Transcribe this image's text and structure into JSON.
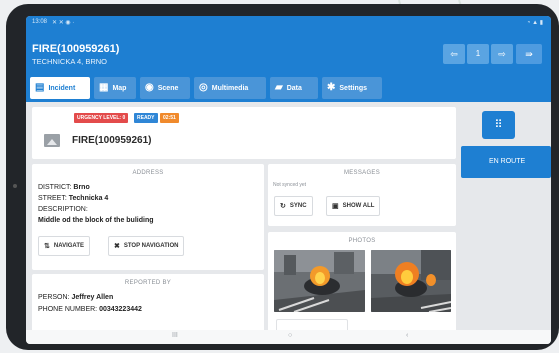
{
  "status_bar": {
    "time": "13:08",
    "icons_left": "✕ ✕ ◉ ·",
    "icons_right": "◔ ▲ ▮"
  },
  "header": {
    "title": "FIRE(100959261)",
    "subtitle": "TECHNICKA 4, BRNO",
    "nav": {
      "prev_icon": "arrow-left-icon",
      "page": "1",
      "next_icon": "arrow-right-icon",
      "exit_icon": "exit-icon"
    }
  },
  "tabs": [
    {
      "label": "Incident",
      "icon": "clipboard-icon",
      "active": true
    },
    {
      "label": "Map",
      "icon": "map-icon",
      "active": false
    },
    {
      "label": "Scene",
      "icon": "pin-icon",
      "active": false
    },
    {
      "label": "Multimedia",
      "icon": "camera-icon",
      "active": false
    },
    {
      "label": "Data",
      "icon": "folder-icon",
      "active": false
    },
    {
      "label": "Settings",
      "icon": "gear-icon",
      "active": false
    }
  ],
  "incident": {
    "badges": {
      "urgency": "URGENCY LEVEL: 0",
      "ready": "READY",
      "time": "02:51"
    },
    "title": "FIRE(100959261)"
  },
  "address": {
    "section_title": "ADDRESS",
    "district_label": "DISTRICT:",
    "district_value": "Brno",
    "street_label": "STREET:",
    "street_value": "Technicka 4",
    "description_label": "DESCRIPTION:",
    "description_value": "Middle od the block of the buliding",
    "navigate_label": "NAVIGATE",
    "stop_navigation_label": "STOP NAVIGATION"
  },
  "messages": {
    "section_title": "MESSAGES",
    "status": "Not synced yet",
    "sync_label": "SYNC",
    "show_all_label": "SHOW ALL"
  },
  "photos": {
    "section_title": "PHOTOS"
  },
  "reported_by": {
    "section_title": "REPORTED BY",
    "person_label": "PERSON:",
    "person_value": "Jeffrey Allen",
    "phone_label": "PHONE NUMBER:",
    "phone_value": "00343223442"
  },
  "side": {
    "enroute_label": "EN ROUTE"
  },
  "bottom_nav": {
    "recent": "III",
    "home": "○",
    "back": "‹"
  },
  "colors": {
    "primary": "#1e7fd2",
    "urgency": "#e34b4b",
    "ready": "#2f86d6",
    "timer": "#f08a2c"
  }
}
